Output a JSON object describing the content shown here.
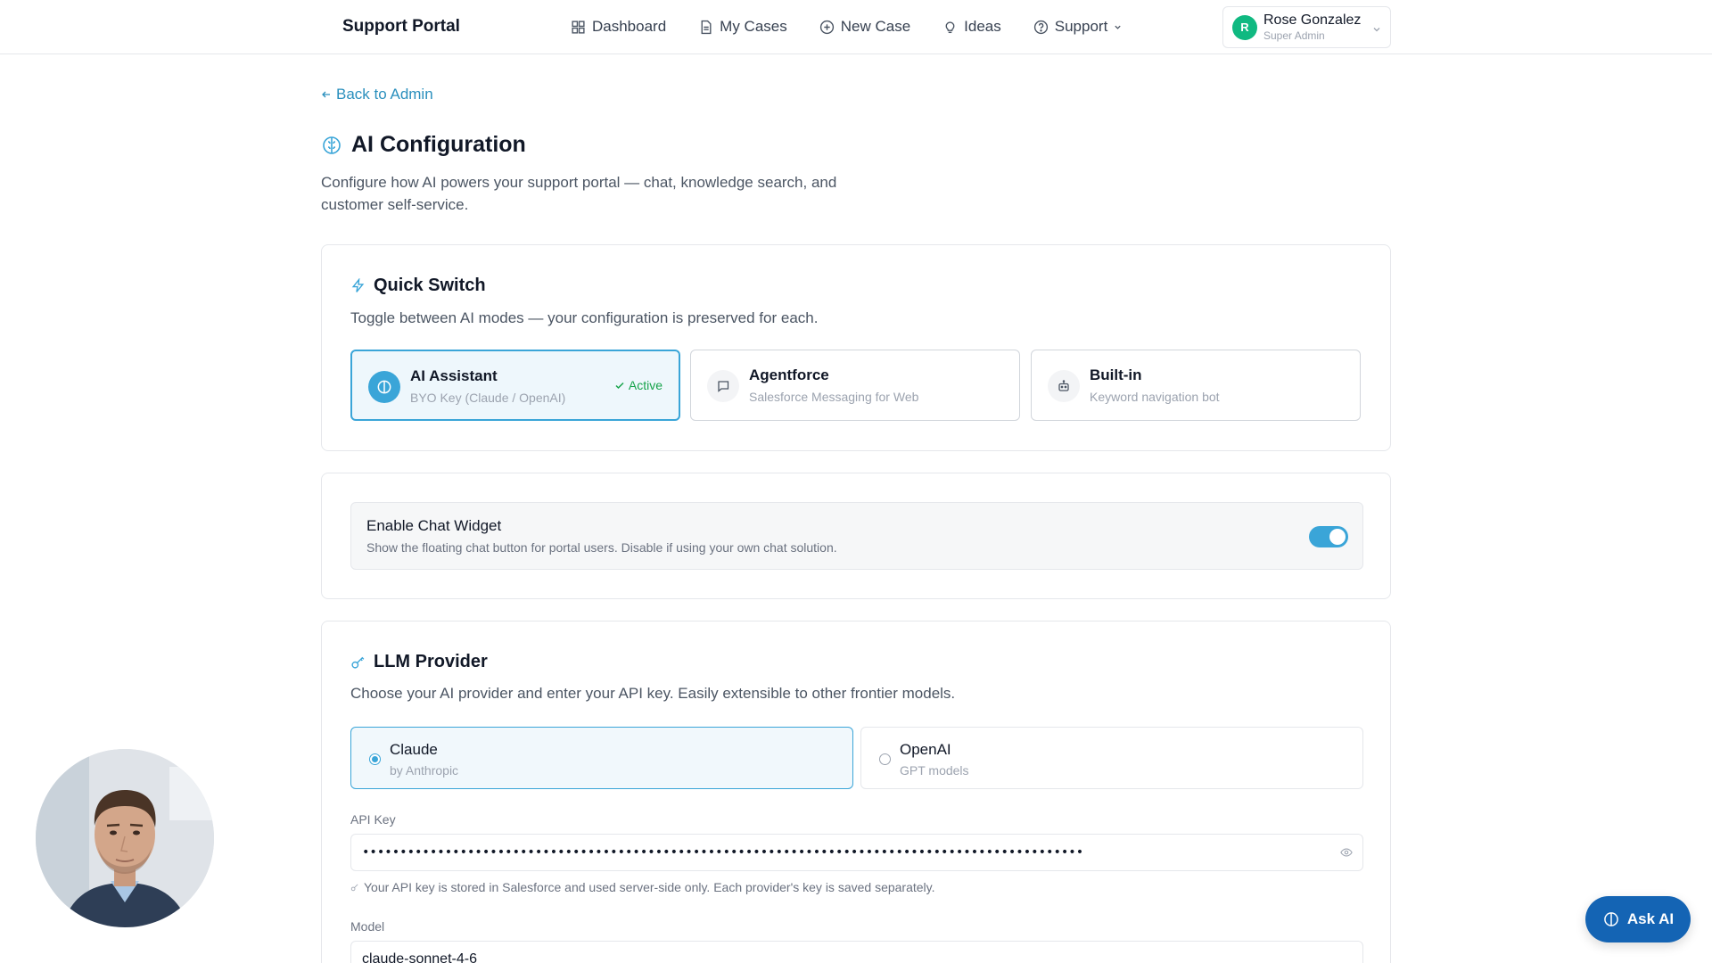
{
  "header": {
    "brand": "Support Portal",
    "nav": [
      {
        "label": "Dashboard",
        "icon": "grid-icon"
      },
      {
        "label": "My Cases",
        "icon": "document-icon"
      },
      {
        "label": "New Case",
        "icon": "plus-circle-icon"
      },
      {
        "label": "Ideas",
        "icon": "lightbulb-icon"
      },
      {
        "label": "Support",
        "icon": "help-circle-icon"
      }
    ],
    "user": {
      "initial": "R",
      "name": "Rose Gonzalez",
      "role": "Super Admin"
    }
  },
  "page": {
    "back_label": "Back to Admin",
    "title": "AI Configuration",
    "description": "Configure how AI powers your support portal — chat, knowledge search, and customer self-service."
  },
  "quick_switch": {
    "title": "Quick Switch",
    "description": "Toggle between AI modes — your configuration is preserved for each.",
    "modes": [
      {
        "title": "AI Assistant",
        "subtitle": "BYO Key (Claude / OpenAI)",
        "icon": "brain-icon",
        "active": true,
        "badge": "Active"
      },
      {
        "title": "Agentforce",
        "subtitle": "Salesforce Messaging for Web",
        "icon": "chat-icon",
        "active": false
      },
      {
        "title": "Built-in",
        "subtitle": "Keyword navigation bot",
        "icon": "bot-icon",
        "active": false
      }
    ]
  },
  "chat_widget": {
    "title": "Enable Chat Widget",
    "description": "Show the floating chat button for portal users. Disable if using your own chat solution.",
    "enabled": true
  },
  "llm_provider": {
    "title": "LLM Provider",
    "description": "Choose your AI provider and enter your API key. Easily extensible to other frontier models.",
    "providers": [
      {
        "name": "Claude",
        "subtitle": "by Anthropic",
        "selected": true
      },
      {
        "name": "OpenAI",
        "subtitle": "GPT models",
        "selected": false
      }
    ],
    "api_key_label": "API Key",
    "api_key_value": "••••••••••••••••••••••••••••••••••••••••••••••••••••••••••••••••••••••••••••••••••••••••••••••••",
    "api_key_hint": "Your API key is stored in Salesforce and used server-side only. Each provider's key is saved separately.",
    "model_label": "Model",
    "model_value": "claude-sonnet-4-6"
  },
  "ask_ai": {
    "label": "Ask AI"
  },
  "colors": {
    "accent": "#3aa5d8",
    "link": "#2a8fbd",
    "ask_ai_bg": "#1464b4",
    "active_green": "#16a34a"
  }
}
